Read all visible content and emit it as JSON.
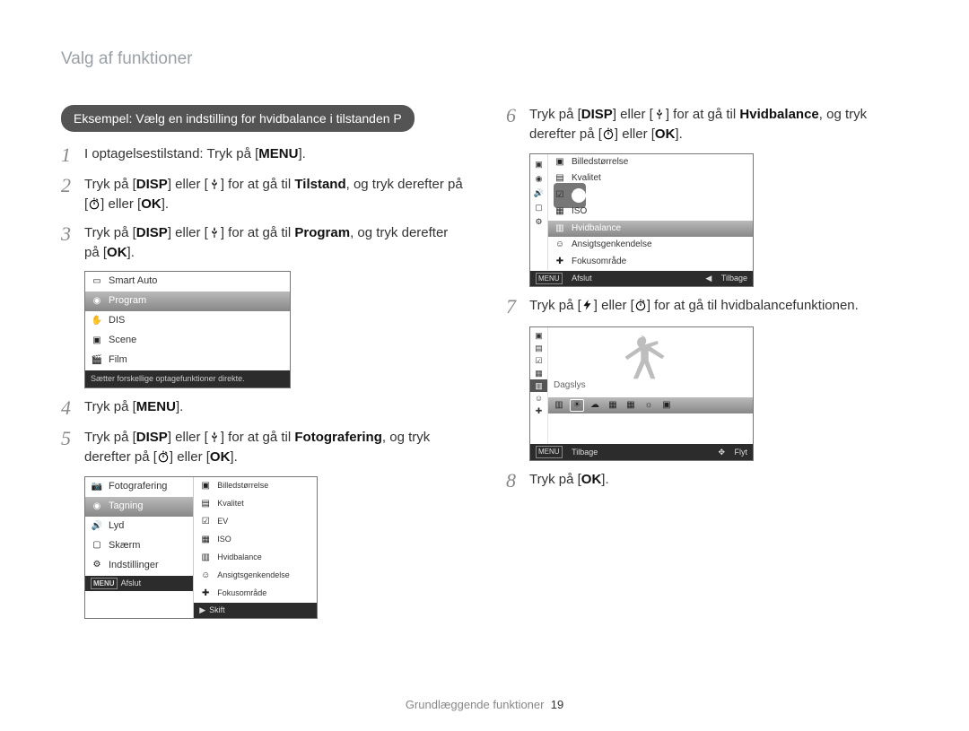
{
  "header": "Valg af funktioner",
  "callout": "Eksempel: Vælg en indstilling for hvidbalance i tilstanden P",
  "footer": {
    "label": "Grundlæggende funktioner",
    "page_num": "19"
  },
  "left": {
    "steps": {
      "1": {
        "pre": "I optagelsestilstand: Tryk på ",
        "btn": "MENU",
        "post": "."
      },
      "2": {
        "pre": "Tryk på ",
        "btn1": "DISP",
        "mid1": " eller ",
        "mid2": " for at gå til ",
        "target": "Tilstand",
        "post1": ", og tryk derefter på ",
        "post2": " eller ",
        "btn2": "OK",
        "post3": "."
      },
      "3": {
        "pre": "Tryk på ",
        "btn1": "DISP",
        "mid1": " eller ",
        "mid2": " for at gå til ",
        "target": "Program",
        "post1": ", og tryk derefter på ",
        "btn2": "OK",
        "post2": "."
      },
      "4": {
        "pre": "Tryk på ",
        "btn": "MENU",
        "post": "."
      },
      "5": {
        "pre": "Tryk på ",
        "btn1": "DISP",
        "mid1": " eller ",
        "mid2": " for at gå til ",
        "target": "Fotografering",
        "post1": ", og tryk derefter på ",
        "post2": " eller ",
        "btn2": "OK",
        "post3": "."
      }
    },
    "menu1": {
      "items": [
        "Smart Auto",
        "Program",
        "DIS",
        "Scene",
        "Film"
      ],
      "selected": "Program",
      "note": "Sætter forskellige optagefunktioner direkte."
    },
    "menu2": {
      "left_items": [
        "Fotografering",
        "Tagning",
        "Lyd",
        "Skærm",
        "Indstillinger"
      ],
      "left_selected": "Tagning",
      "right_items": [
        "Billedstørrelse",
        "Kvalitet",
        "EV",
        "ISO",
        "Hvidbalance",
        "Ansigtsgenkendelse",
        "Fokusområde"
      ],
      "foot_left_label": "Afslut",
      "foot_left_btn": "MENU",
      "foot_right_label": "Skift",
      "foot_right_glyph": "▶"
    }
  },
  "right": {
    "steps": {
      "6": {
        "pre": "Tryk på ",
        "btn1": "DISP",
        "mid1": " eller ",
        "mid2": " for at gå til ",
        "target": "Hvidbalance",
        "post1": ", og tryk derefter på ",
        "post2": " eller ",
        "btn2": "OK",
        "post3": "."
      },
      "7": {
        "pre": "Tryk på ",
        "mid": " eller ",
        "post": " for at gå til hvidbalancefunktionen."
      },
      "8": {
        "pre": "Tryk på ",
        "btn": "OK",
        "post": "."
      }
    },
    "menu3": {
      "items": [
        "Billedstørrelse",
        "Kvalitet",
        "EV",
        "ISO",
        "Hvidbalance",
        "Ansigtsgenkendelse",
        "Fokusområde"
      ],
      "selected": "Hvidbalance",
      "foot_left_label": "Afslut",
      "foot_left_btn": "MENU",
      "foot_right_label": "Tilbage",
      "foot_right_glyph": "◀"
    },
    "preview": {
      "label": "Dagslys",
      "foot_left_label": "Tilbage",
      "foot_left_btn": "MENU",
      "foot_right_label": "Flyt",
      "foot_right_glyph": "✥"
    }
  }
}
